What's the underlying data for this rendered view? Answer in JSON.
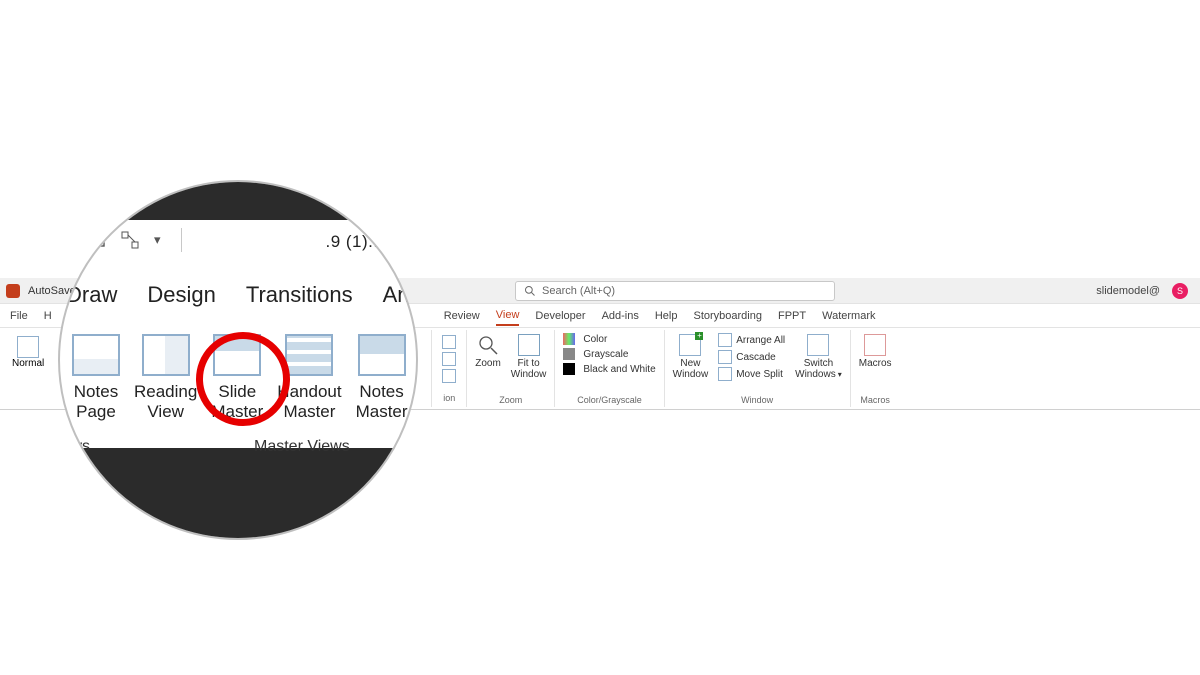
{
  "title_row": {
    "autosave": "AutoSave",
    "search_placeholder": "Search (Alt+Q)",
    "username": "slidemodel@",
    "avatar_letter": "S"
  },
  "tabs": {
    "file": "File",
    "home_frag": "H",
    "review": "Review",
    "view": "View",
    "developer": "Developer",
    "addins": "Add-ins",
    "help": "Help",
    "storyboarding": "Storyboarding",
    "fppt": "FPPT",
    "watermark": "Watermark"
  },
  "ribbon": {
    "normal": "Normal",
    "zoom_group": {
      "zoom": "Zoom",
      "fit": "Fit to\nWindow",
      "label": "Zoom"
    },
    "color_group": {
      "color": "Color",
      "grayscale": "Grayscale",
      "bw": "Black and White",
      "label": "Color/Grayscale"
    },
    "window_group": {
      "new_window": "New\nWindow",
      "arrange": "Arrange All",
      "cascade": "Cascade",
      "move_split": "Move Split",
      "switch": "Switch\nWindows",
      "label": "Window"
    },
    "macros_group": {
      "macros": "Macros",
      "label": "Macros"
    }
  },
  "magnifier": {
    "file_title_fragment": ".9 (1)... ∨",
    "tabs": {
      "draw": "Draw",
      "design": "Design",
      "transitions": "Transitions",
      "animations": "Animatio"
    },
    "buttons": {
      "notes_page": "Notes\nPage",
      "reading_view": "Reading\nView",
      "slide_master": "Slide\nMaster",
      "handout_master": "Handout\nMaster",
      "notes_master": "Notes\nMaster"
    },
    "group_frag": ".ws",
    "group_master": "Master Views"
  }
}
